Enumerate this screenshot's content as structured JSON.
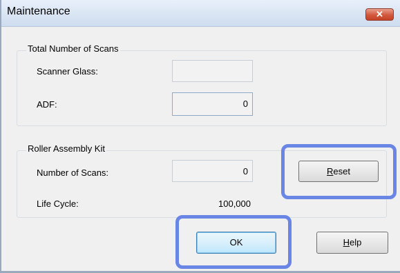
{
  "window": {
    "title": "Maintenance",
    "close_icon": "close-icon"
  },
  "total_scans": {
    "title": "Total Number of Scans",
    "scanner_glass_label": "Scanner Glass:",
    "scanner_glass_value": "",
    "adf_label": "ADF:",
    "adf_value": "0"
  },
  "roller_kit": {
    "title": "Roller Assembly Kit",
    "number_of_scans_label": "Number of Scans:",
    "number_of_scans_value": "0",
    "life_cycle_label": "Life Cycle:",
    "life_cycle_value": "100,000"
  },
  "buttons": {
    "reset_mnemonic": "R",
    "reset_rest": "eset",
    "ok": "OK",
    "help_mnemonic": "H",
    "help_rest": "elp"
  },
  "colors": {
    "highlight": "#6a86e5",
    "titlebar": "#dbe6f4"
  }
}
